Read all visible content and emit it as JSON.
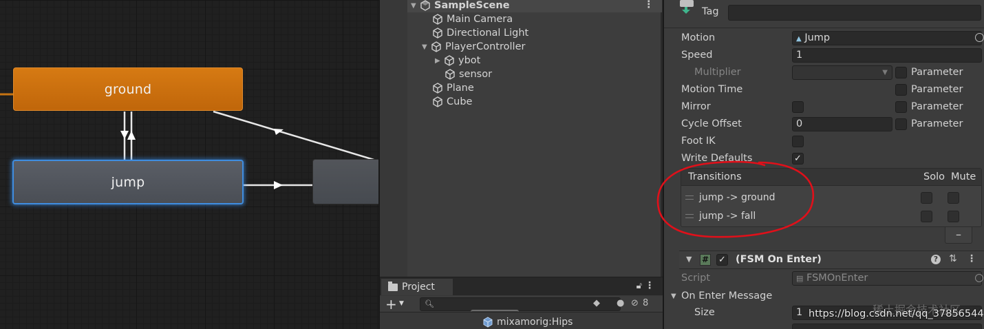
{
  "animator": {
    "states": [
      {
        "label": "ground",
        "color": "#d27713"
      },
      {
        "label": "jump",
        "color": "#53575e"
      },
      {
        "label": "",
        "color": "#4c4f54"
      }
    ]
  },
  "hierarchy": {
    "scene": "SampleScene",
    "items": [
      {
        "label": "Main Camera"
      },
      {
        "label": "Directional Light"
      },
      {
        "label": "PlayerController"
      },
      {
        "label": "ybot"
      },
      {
        "label": "sensor"
      },
      {
        "label": "Plane"
      },
      {
        "label": "Cube"
      }
    ]
  },
  "project": {
    "tab_label": "Project",
    "search_placeholder": "",
    "hidden_count": "8",
    "visible_item": "mixamorig:Hips"
  },
  "inspector": {
    "tag_label": "Tag",
    "motion_label": "Motion",
    "motion_value": "Jump",
    "speed_label": "Speed",
    "speed_value": "1",
    "multiplier_label": "Multiplier",
    "parameter_label": "Parameter",
    "motion_time_label": "Motion Time",
    "mirror_label": "Mirror",
    "cycle_offset_label": "Cycle Offset",
    "cycle_offset_value": "0",
    "foot_ik_label": "Foot IK",
    "write_defaults_label": "Write Defaults",
    "transitions": {
      "header": "Transitions",
      "solo": "Solo",
      "mute": "Mute",
      "items": [
        {
          "label": "jump -> ground"
        },
        {
          "label": "jump -> fall"
        }
      ],
      "remove_label": "–"
    },
    "component": {
      "title": "(FSM On Enter)",
      "script_label": "Script",
      "script_value": "FSMOnEnter",
      "on_enter_label": "On Enter Message",
      "size_label": "Size",
      "size_value": "1"
    }
  },
  "watermark": {
    "url": "https://blog.csdn.net/qq_37856544",
    "cn": "稀土掘金技术社区"
  },
  "colors": {
    "accent_blue": "#3f8de0",
    "annotation_red": "#e0101a"
  }
}
